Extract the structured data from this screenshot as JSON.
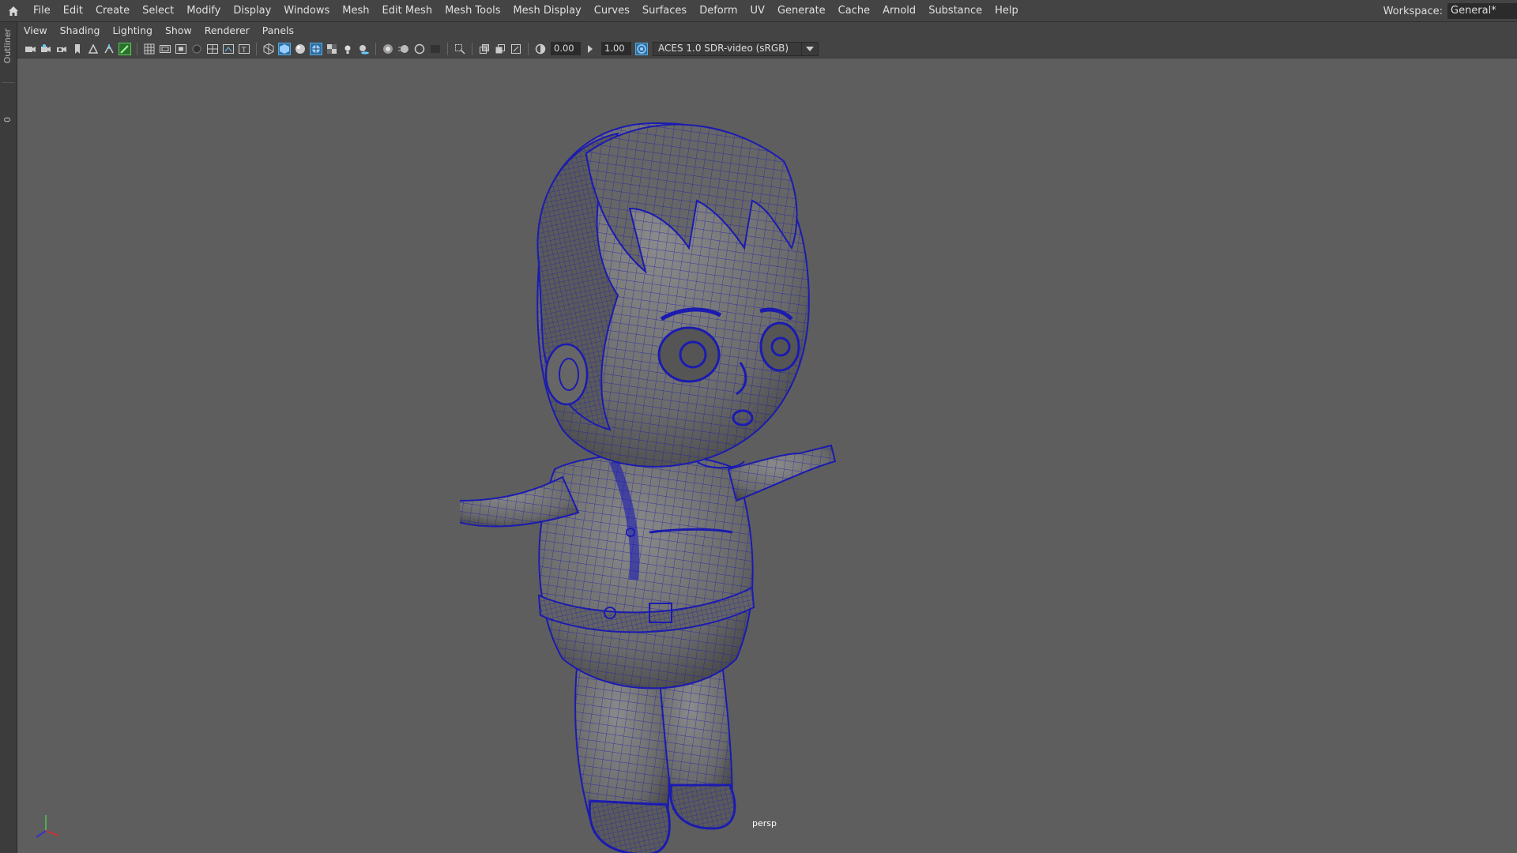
{
  "menubar": {
    "items": [
      "File",
      "Edit",
      "Create",
      "Select",
      "Modify",
      "Display",
      "Windows",
      "Mesh",
      "Edit Mesh",
      "Mesh Tools",
      "Mesh Display",
      "Curves",
      "Surfaces",
      "Deform",
      "UV",
      "Generate",
      "Cache",
      "Arnold",
      "Substance",
      "Help"
    ],
    "workspace_label": "Workspace:",
    "workspace_value": "General*"
  },
  "left_strip": {
    "outliner_label": "Outliner",
    "index_label": "0"
  },
  "panel_menu": [
    "View",
    "Shading",
    "Lighting",
    "Show",
    "Renderer",
    "Panels"
  ],
  "toolbar": {
    "exposure_value": "0.00",
    "gamma_value": "1.00",
    "color_space": "ACES 1.0 SDR-video (sRGB)",
    "icons": [
      "camera-icon",
      "camera-attributes-icon",
      "bookmark-icon",
      "image-plane-icon",
      "grid-icon",
      "film-gate-icon",
      "resolution-gate-icon",
      "gate-mask-icon",
      "field-chart-icon",
      "safe-action-icon",
      "safe-title-icon",
      "wireframe-icon",
      "smooth-shade-icon",
      "default-material-icon",
      "wireframe-on-shaded-icon",
      "textured-icon",
      "lights-icon",
      "shadows-icon",
      "ambient-occlusion-icon",
      "motion-blur-icon",
      "anti-aliasing-icon",
      "depth-of-field-icon",
      "isolate-select-icon",
      "xray-icon",
      "xray-joints-icon",
      "backface-culling-icon"
    ]
  },
  "viewport": {
    "camera_name": "persp",
    "wire_color": "#1b1bb0",
    "background_color": "#5e5e5e"
  }
}
